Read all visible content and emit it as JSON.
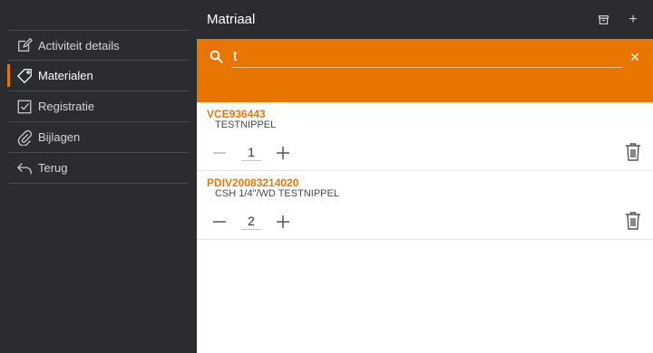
{
  "header": {
    "title": "Matriaal",
    "archive_icon": "archive-icon",
    "add_label": "+"
  },
  "sidebar": {
    "items": [
      {
        "label": "Activiteit details",
        "icon": "edit-icon"
      },
      {
        "label": "Materialen",
        "icon": "tag-icon",
        "active": true
      },
      {
        "label": "Registratie",
        "icon": "checkbox-icon"
      },
      {
        "label": "Bijlagen",
        "icon": "paperclip-icon"
      },
      {
        "label": "Terug",
        "icon": "back-arrow-icon"
      }
    ]
  },
  "search": {
    "value": "t",
    "clear_label": "✕"
  },
  "materials": [
    {
      "code": "VCE936443",
      "description": "TESTNIPPEL",
      "quantity": "1"
    },
    {
      "code": "PDIV20083214020",
      "description": "CSH 1/4\"/WD TESTNIPPEL",
      "quantity": "2"
    }
  ],
  "colors": {
    "accent": "#e87500",
    "sidebar_bg": "#2b2c30",
    "code_text": "#e07a13"
  }
}
